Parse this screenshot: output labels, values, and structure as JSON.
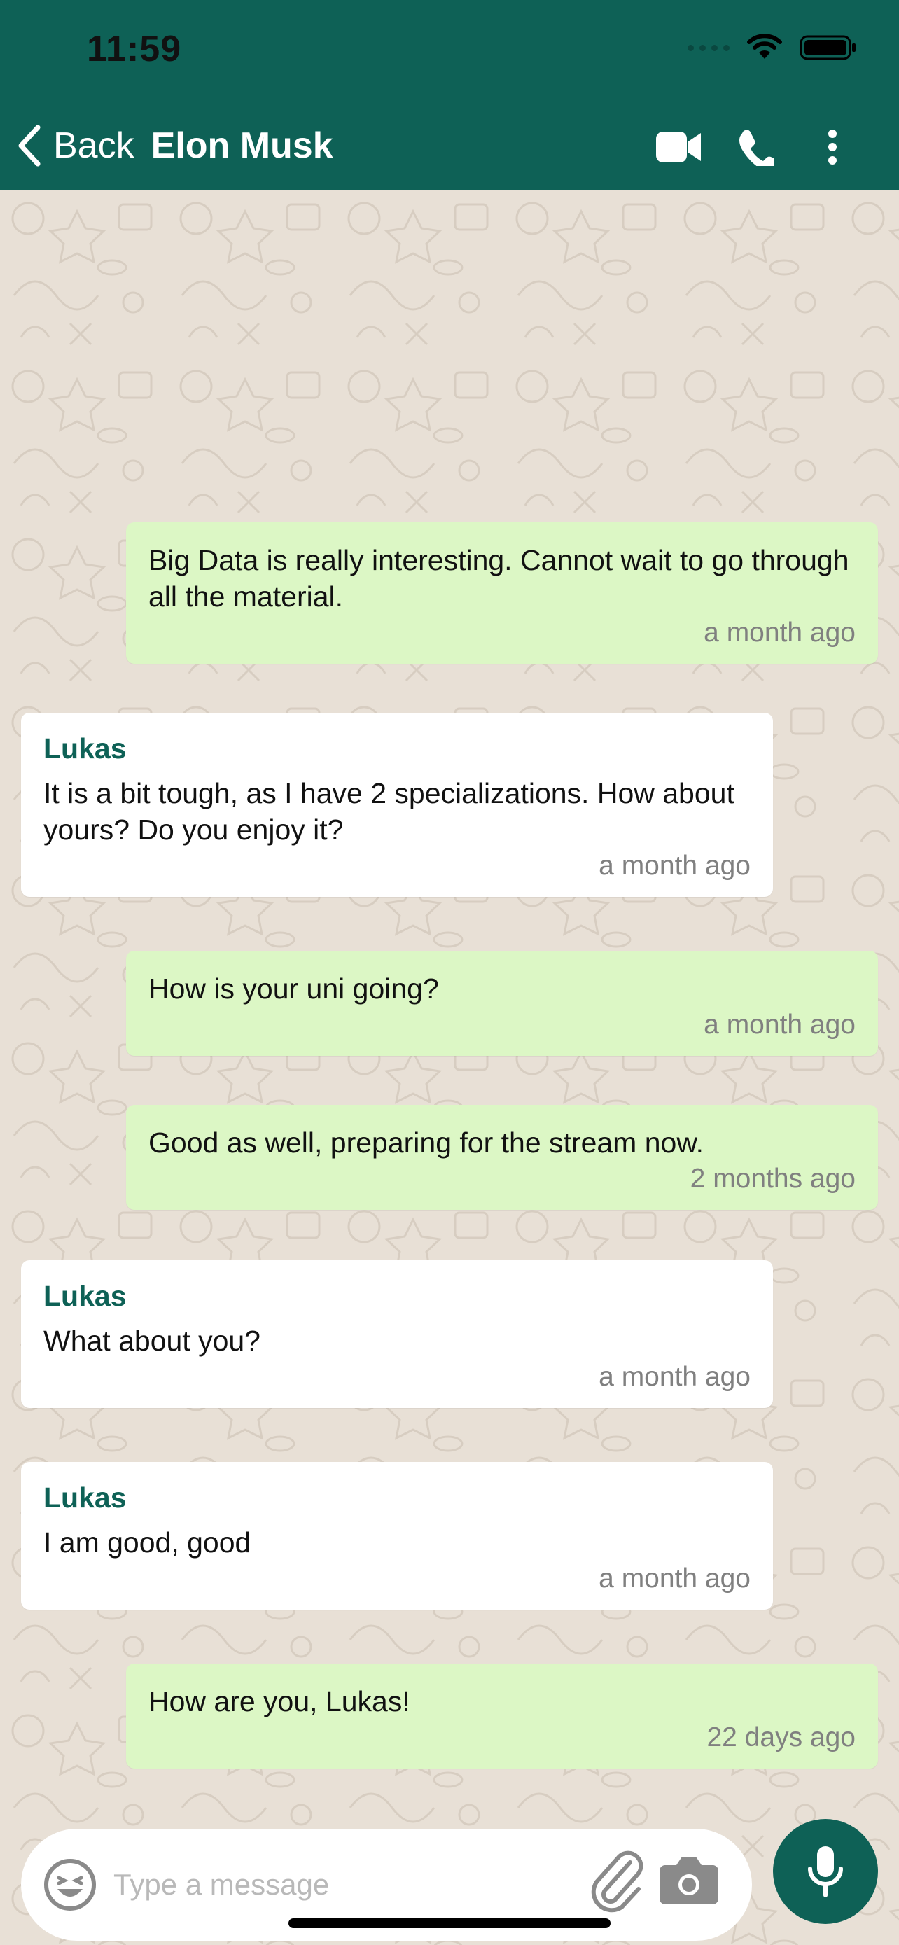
{
  "status_bar": {
    "time": "11:59"
  },
  "header": {
    "back_label": "Back",
    "contact_name": "Elon Musk",
    "actions": [
      "video-call-icon",
      "phone-icon",
      "more-vertical-icon"
    ],
    "color": "#0e6156"
  },
  "messages": [
    {
      "direction": "out",
      "text": "Big Data is really interesting. Cannot wait to go through all the material.",
      "time": "a month ago"
    },
    {
      "direction": "in",
      "sender": "Lukas",
      "text": "It is a bit tough, as I have 2 specializations. How about yours? Do you enjoy it?",
      "time": "a month ago"
    },
    {
      "direction": "out",
      "text": "How is your uni going?",
      "time": "a month ago"
    },
    {
      "direction": "out",
      "text": "Good as well, preparing for the stream now.",
      "time": "2 months ago"
    },
    {
      "direction": "in",
      "sender": "Lukas",
      "text": "What about you?",
      "time": "a month ago"
    },
    {
      "direction": "in",
      "sender": "Lukas",
      "text": "I am good, good",
      "time": "a month ago"
    },
    {
      "direction": "out",
      "text": "How are you, Lukas!",
      "time": "22 days ago"
    }
  ],
  "composer": {
    "placeholder": "Type a message",
    "value": "",
    "icons": [
      "emoji-icon",
      "paperclip-icon",
      "camera-icon",
      "microphone-icon"
    ]
  },
  "colors": {
    "outgoing_bubble": "#dcf7c5",
    "incoming_bubble": "#ffffff",
    "accent": "#0e6156",
    "chat_background": "#e8e0d6"
  }
}
